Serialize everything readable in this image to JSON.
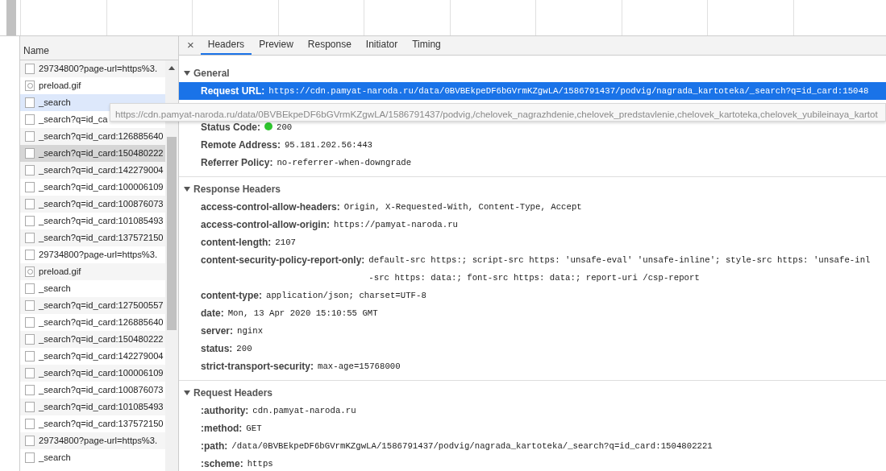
{
  "requests": {
    "column": "Name",
    "rows": [
      {
        "name": "29734800?page-url=https%3.",
        "kind": "document",
        "selected": false,
        "hovered": false
      },
      {
        "name": "preload.gif",
        "kind": "image",
        "selected": false,
        "hovered": false
      },
      {
        "name": "_search",
        "kind": "document",
        "selected": false,
        "hovered": true
      },
      {
        "name": "_search?q=id_ca",
        "kind": "document",
        "selected": false,
        "hovered": false
      },
      {
        "name": "_search?q=id_card:126885640",
        "kind": "document",
        "selected": false,
        "hovered": false
      },
      {
        "name": "_search?q=id_card:150480222",
        "kind": "document",
        "selected": true,
        "hovered": false
      },
      {
        "name": "_search?q=id_card:142279004",
        "kind": "document",
        "selected": false,
        "hovered": false
      },
      {
        "name": "_search?q=id_card:100006109",
        "kind": "document",
        "selected": false,
        "hovered": false
      },
      {
        "name": "_search?q=id_card:100876073",
        "kind": "document",
        "selected": false,
        "hovered": false
      },
      {
        "name": "_search?q=id_card:101085493",
        "kind": "document",
        "selected": false,
        "hovered": false
      },
      {
        "name": "_search?q=id_card:137572150",
        "kind": "document",
        "selected": false,
        "hovered": false
      },
      {
        "name": "29734800?page-url=https%3.",
        "kind": "document",
        "selected": false,
        "hovered": false
      },
      {
        "name": "preload.gif",
        "kind": "image",
        "selected": false,
        "hovered": false
      },
      {
        "name": "_search",
        "kind": "document",
        "selected": false,
        "hovered": false
      },
      {
        "name": "_search?q=id_card:127500557",
        "kind": "document",
        "selected": false,
        "hovered": false
      },
      {
        "name": "_search?q=id_card:126885640",
        "kind": "document",
        "selected": false,
        "hovered": false
      },
      {
        "name": "_search?q=id_card:150480222",
        "kind": "document",
        "selected": false,
        "hovered": false
      },
      {
        "name": "_search?q=id_card:142279004",
        "kind": "document",
        "selected": false,
        "hovered": false
      },
      {
        "name": "_search?q=id_card:100006109",
        "kind": "document",
        "selected": false,
        "hovered": false
      },
      {
        "name": "_search?q=id_card:100876073",
        "kind": "document",
        "selected": false,
        "hovered": false
      },
      {
        "name": "_search?q=id_card:101085493",
        "kind": "document",
        "selected": false,
        "hovered": false
      },
      {
        "name": "_search?q=id_card:137572150",
        "kind": "document",
        "selected": false,
        "hovered": false
      },
      {
        "name": "29734800?page-url=https%3.",
        "kind": "document",
        "selected": false,
        "hovered": false
      },
      {
        "name": "_search",
        "kind": "document",
        "selected": false,
        "hovered": false
      }
    ]
  },
  "details": {
    "close": "×",
    "tabs": [
      {
        "label": "Headers",
        "selected": true
      },
      {
        "label": "Preview",
        "selected": false
      },
      {
        "label": "Response",
        "selected": false
      },
      {
        "label": "Initiator",
        "selected": false
      },
      {
        "label": "Timing",
        "selected": false
      }
    ],
    "sections": [
      {
        "title": "General",
        "expanded": true,
        "rows": [
          {
            "name": "Request URL:",
            "value": [
              "https://cdn.pamyat-naroda.ru/data/0BVBEkpeDF6bGVrmKZgwLA/1586791437/podvig/nagrada_kartoteka/_search?q=id_card:15048"
            ],
            "highlighted": true
          },
          {
            "name": "Status Code:",
            "value": [
              "200"
            ],
            "highlighted": false,
            "status_dot": true
          },
          {
            "name": "Remote Address:",
            "value": [
              "95.181.202.56:443"
            ],
            "highlighted": false
          },
          {
            "name": "Referrer Policy:",
            "value": [
              "no-referrer-when-downgrade"
            ],
            "highlighted": false
          }
        ]
      },
      {
        "title": "Response Headers",
        "expanded": true,
        "rows": [
          {
            "name": "access-control-allow-headers:",
            "value": [
              "Origin, X-Requested-With, Content-Type, Accept"
            ],
            "highlighted": false
          },
          {
            "name": "access-control-allow-origin:",
            "value": [
              "https://pamyat-naroda.ru"
            ],
            "highlighted": false
          },
          {
            "name": "content-length:",
            "value": [
              "2107"
            ],
            "highlighted": false
          },
          {
            "name": "content-security-policy-report-only:",
            "value": [
              "default-src https:; script-src https: 'unsafe-eval' 'unsafe-inline'; style-src https: 'unsafe-inl",
              "-src https: data:; font-src https: data:; report-uri /csp-report"
            ],
            "highlighted": false
          },
          {
            "name": "content-type:",
            "value": [
              "application/json; charset=UTF-8"
            ],
            "highlighted": false
          },
          {
            "name": "date:",
            "value": [
              "Mon, 13 Apr 2020 15:10:55 GMT"
            ],
            "highlighted": false
          },
          {
            "name": "server:",
            "value": [
              "nginx"
            ],
            "highlighted": false
          },
          {
            "name": "status:",
            "value": [
              "200"
            ],
            "highlighted": false
          },
          {
            "name": "strict-transport-security:",
            "value": [
              "max-age=15768000"
            ],
            "highlighted": false
          }
        ]
      },
      {
        "title": "Request Headers",
        "expanded": true,
        "rows": [
          {
            "name": ":authority:",
            "value": [
              "cdn.pamyat-naroda.ru"
            ],
            "highlighted": false
          },
          {
            "name": ":method:",
            "value": [
              "GET"
            ],
            "highlighted": false
          },
          {
            "name": ":path:",
            "value": [
              "/data/0BVBEkpeDF6bGVrmKZgwLA/1586791437/podvig/nagrada_kartoteka/_search?q=id_card:1504802221"
            ],
            "highlighted": false
          },
          {
            "name": ":scheme:",
            "value": [
              "https"
            ],
            "highlighted": false
          }
        ]
      }
    ]
  },
  "tooltip": "https://cdn.pamyat-naroda.ru/data/0BVBEkpeDF6bGVrmKZgwLA/1586791437/podvig,/chelovek_nagrazhdenie,chelovek_predstavlenie,chelovek_kartoteka,chelovek_yubileinaya_kartot"
}
